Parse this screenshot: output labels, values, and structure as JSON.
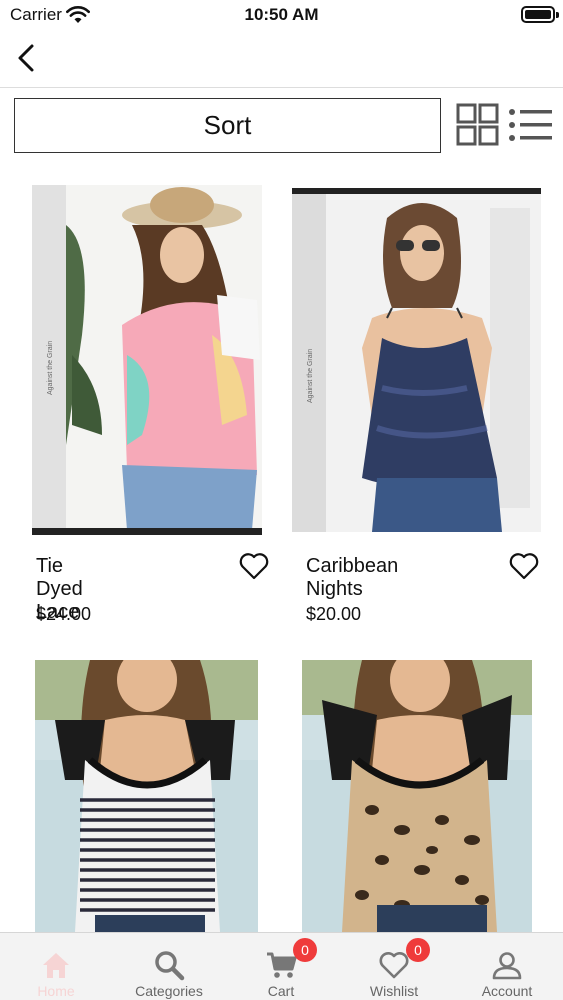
{
  "status_bar": {
    "carrier": "Carrier",
    "time": "10:50 AM"
  },
  "toolbar": {
    "sort_label": "Sort"
  },
  "products": [
    {
      "name": "Tie Dyed Lace",
      "price": "$24.00",
      "image_caption": "Against the Grain"
    },
    {
      "name": "Caribbean Nights",
      "price": "$20.00",
      "image_caption": "Against the Grain"
    },
    {
      "name": "",
      "price": ""
    },
    {
      "name": "",
      "price": ""
    }
  ],
  "tabbar": {
    "tabs": [
      {
        "label": "Home",
        "icon": "home-icon",
        "active": true
      },
      {
        "label": "Categories",
        "icon": "search-icon"
      },
      {
        "label": "Cart",
        "icon": "cart-icon",
        "badge": "0"
      },
      {
        "label": "Wishlist",
        "icon": "heart-icon",
        "badge": "0"
      },
      {
        "label": "Account",
        "icon": "account-icon"
      }
    ]
  },
  "colors": {
    "badge": "#ef3b3b",
    "active_tab": "#f6d4d4",
    "tabbar_bg": "#f3f3f3"
  }
}
